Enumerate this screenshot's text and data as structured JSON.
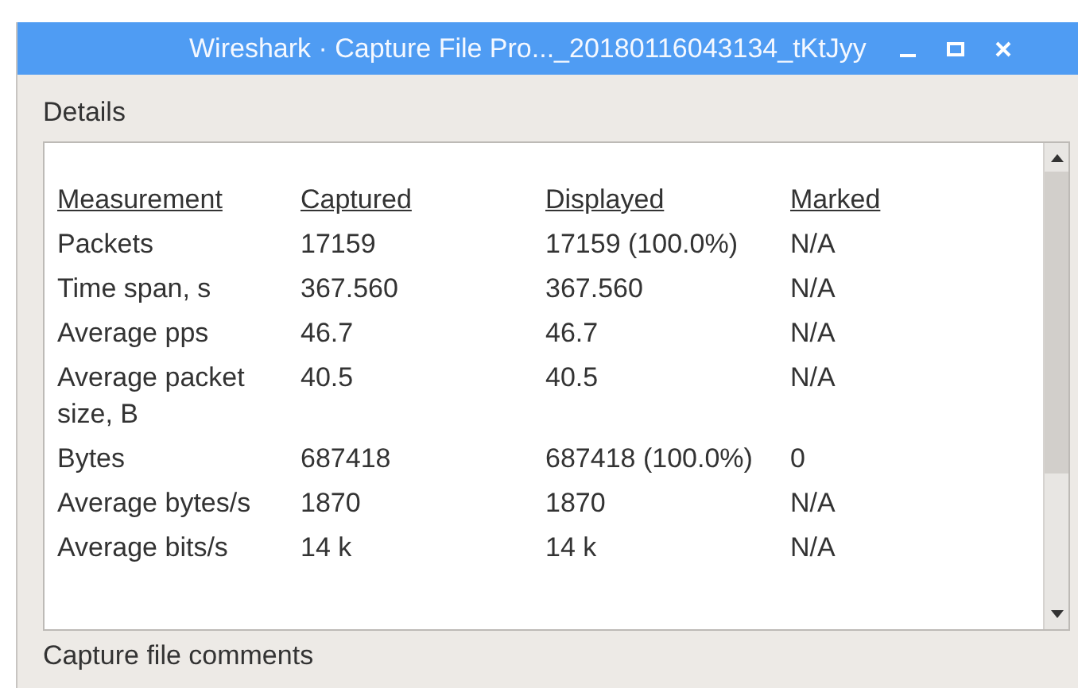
{
  "window": {
    "title": "Wireshark · Capture File Pro..._20180116043134_tKtJyy"
  },
  "details": {
    "label": "Details",
    "columns": [
      "Measurement",
      "Captured",
      "Displayed",
      "Marked"
    ],
    "rows": [
      [
        "Packets",
        "17159",
        "17159 (100.0%)",
        "N/A"
      ],
      [
        "Time span, s",
        "367.560",
        "367.560",
        "N/A"
      ],
      [
        "Average pps",
        "46.7",
        "46.7",
        "N/A"
      ],
      [
        "Average packet size, B",
        "40.5",
        "40.5",
        "N/A"
      ],
      [
        "Bytes",
        "687418",
        "687418 (100.0%)",
        "0"
      ],
      [
        "Average bytes/s",
        "1870",
        "1870",
        "N/A"
      ],
      [
        "Average bits/s",
        "14 k",
        "14 k",
        "N/A"
      ]
    ]
  },
  "comments": {
    "label": "Capture file comments"
  }
}
